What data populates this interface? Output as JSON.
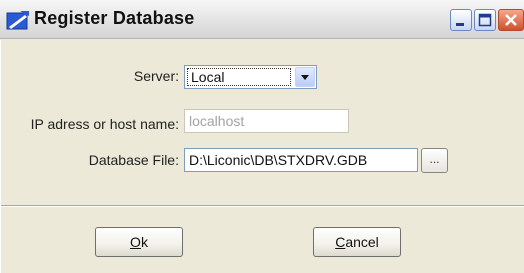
{
  "window": {
    "title": "Register Database"
  },
  "form": {
    "server_label": "Server:",
    "server_value": "Local",
    "host_label": "IP adress or host name:",
    "host_value": "localhost",
    "dbfile_label": "Database File:",
    "dbfile_value": "D:\\Liconic\\DB\\STXDRV.GDB",
    "browse_label": "..."
  },
  "buttons": {
    "ok_mnemonic": "O",
    "ok_rest": "k",
    "cancel_mnemonic": "C",
    "cancel_rest": "ancel"
  },
  "icons": {
    "app": "register-database-icon",
    "minimize": "minimize-icon",
    "maximize": "maximize-icon",
    "close": "close-icon",
    "dropdown": "chevron-down-icon"
  },
  "colors": {
    "titlebar": "#e3e3e3",
    "dialog_bg": "#ece9d8",
    "close_button": "#d0502d"
  }
}
